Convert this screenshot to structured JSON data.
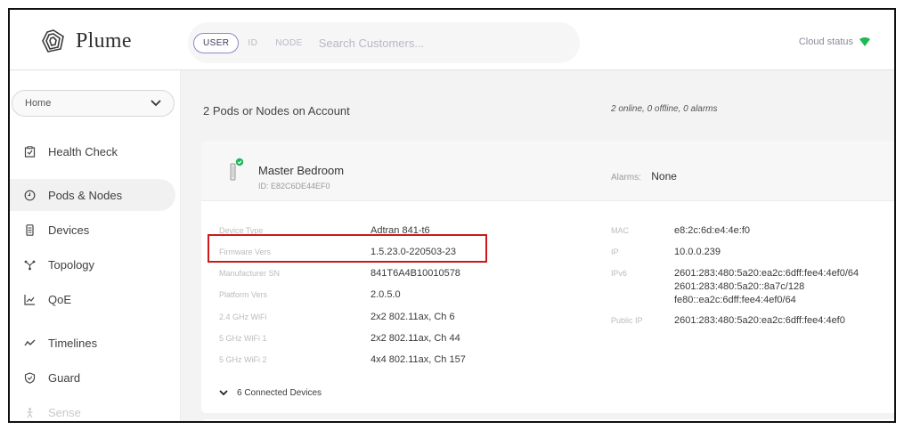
{
  "brand": {
    "name": "Plume"
  },
  "search": {
    "modes": [
      "USER",
      "ID",
      "NODE"
    ],
    "active_mode": "USER",
    "placeholder": "Search Customers..."
  },
  "cloud_status": {
    "label": "Cloud status",
    "color": "#1db954"
  },
  "sidebar": {
    "home_select": "Home",
    "items": [
      {
        "label": "Health Check",
        "icon": "clipboard-icon"
      },
      {
        "label": "Pods & Nodes",
        "icon": "clock-circle-icon",
        "active": true
      },
      {
        "label": "Devices",
        "icon": "device-icon"
      },
      {
        "label": "Topology",
        "icon": "topology-icon"
      },
      {
        "label": "QoE",
        "icon": "chart-line-icon"
      },
      {
        "label": "Timelines",
        "icon": "timeline-icon"
      },
      {
        "label": "Guard",
        "icon": "shield-icon"
      },
      {
        "label": "Sense",
        "icon": "sense-icon",
        "disabled": true
      }
    ]
  },
  "main": {
    "header": "2 Pods or Nodes on Account",
    "summary": "2 online, 0 offline, 0 alarms"
  },
  "pod": {
    "name": "Master Bedroom",
    "id": "ID: E82C6DE44EF0",
    "status_color": "#1db954",
    "alarms_label": "Alarms:",
    "alarms_value": "None",
    "details": [
      {
        "label": "Device Type",
        "value": "Adtran 841-t6"
      },
      {
        "label": "Firmware Vers",
        "value": "1.5.23.0-220503-23"
      },
      {
        "label": "Manufacturer SN",
        "value": "841T6A4B10010578"
      },
      {
        "label": "Platform Vers",
        "value": "2.0.5.0"
      },
      {
        "label": "2.4 GHz WiFi",
        "value": "2x2 802.11ax, Ch 6"
      },
      {
        "label": "5 GHz WiFi 1",
        "value": "2x2 802.11ax, Ch 44"
      },
      {
        "label": "5 GHz WiFi 2",
        "value": "4x4 802.11ax, Ch 157"
      }
    ],
    "network": {
      "mac_label": "MAC",
      "mac": "e8:2c:6d:e4:4e:f0",
      "ip_label": "IP",
      "ip": "10.0.0.239",
      "ipv6_label": "IPv6",
      "ipv6": [
        "2601:283:480:5a20:ea2c:6dff:fee4:4ef0/64",
        "2601:283:480:5a20::8a7c/128",
        "fe80::ea2c:6dff:fee4:4ef0/64"
      ],
      "public_ip_label": "Public IP",
      "public_ip": "2601:283:480:5a20:ea2c:6dff:fee4:4ef0"
    },
    "connected_devices": "6 Connected Devices"
  },
  "highlight_color": "#cc1a1a"
}
